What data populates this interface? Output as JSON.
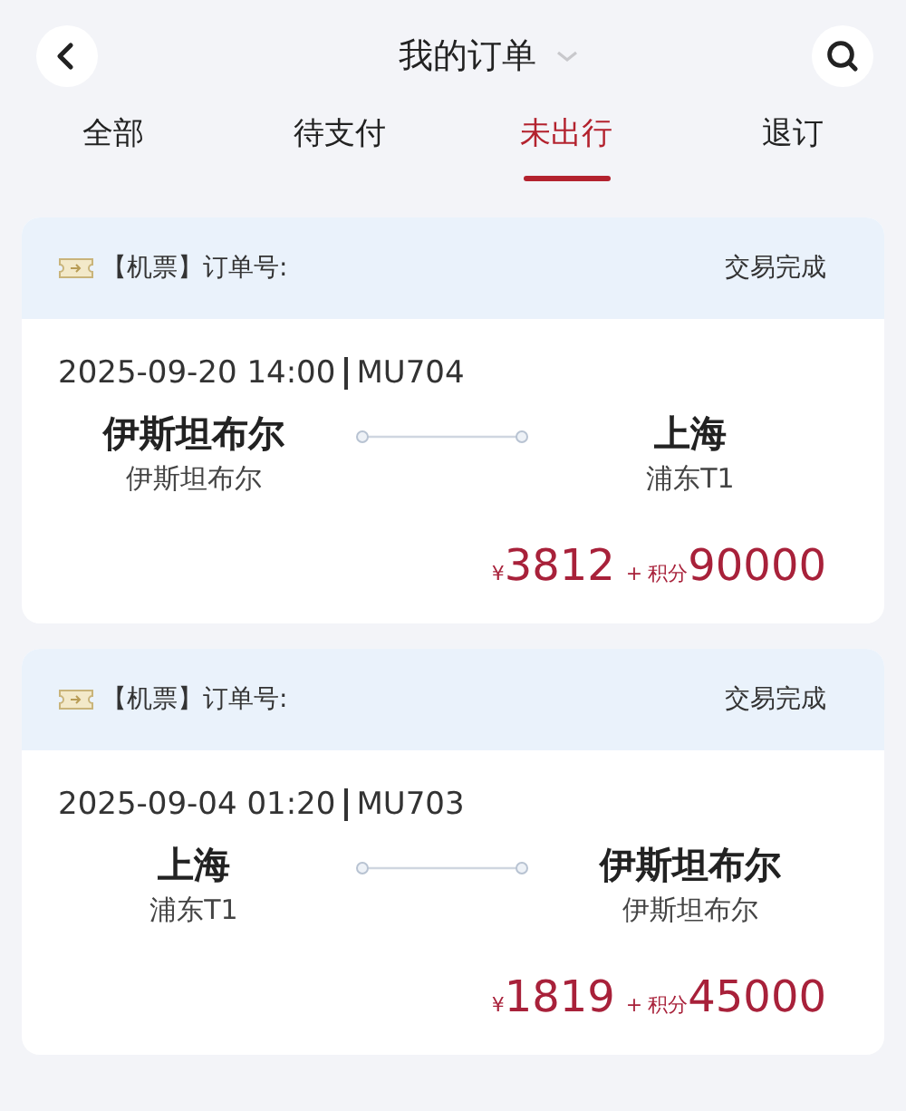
{
  "header": {
    "title": "我的订单"
  },
  "tabs": [
    {
      "label": "全部",
      "selected": false
    },
    {
      "label": "待支付",
      "selected": false
    },
    {
      "label": "未出行",
      "selected": true
    },
    {
      "label": "退订",
      "selected": false
    }
  ],
  "orders": [
    {
      "type": "【机票】",
      "order_no_label": "订单号:",
      "status": "交易完成",
      "datetime": "2025-09-20 14:00",
      "flight": "MU704",
      "from": {
        "city": "伊斯坦布尔",
        "airport": "伊斯坦布尔"
      },
      "to": {
        "city": "上海",
        "airport": "浦东T1"
      },
      "price": {
        "currency": "¥",
        "amount": "3812",
        "connector": "+",
        "points_label": "积分",
        "points": "90000"
      }
    },
    {
      "type": "【机票】",
      "order_no_label": "订单号:",
      "status": "交易完成",
      "datetime": "2025-09-04 01:20",
      "flight": "MU703",
      "from": {
        "city": "上海",
        "airport": "浦东T1"
      },
      "to": {
        "city": "伊斯坦布尔",
        "airport": "伊斯坦布尔"
      },
      "price": {
        "currency": "¥",
        "amount": "1819",
        "connector": "+",
        "points_label": "积分",
        "points": "45000"
      }
    }
  ]
}
